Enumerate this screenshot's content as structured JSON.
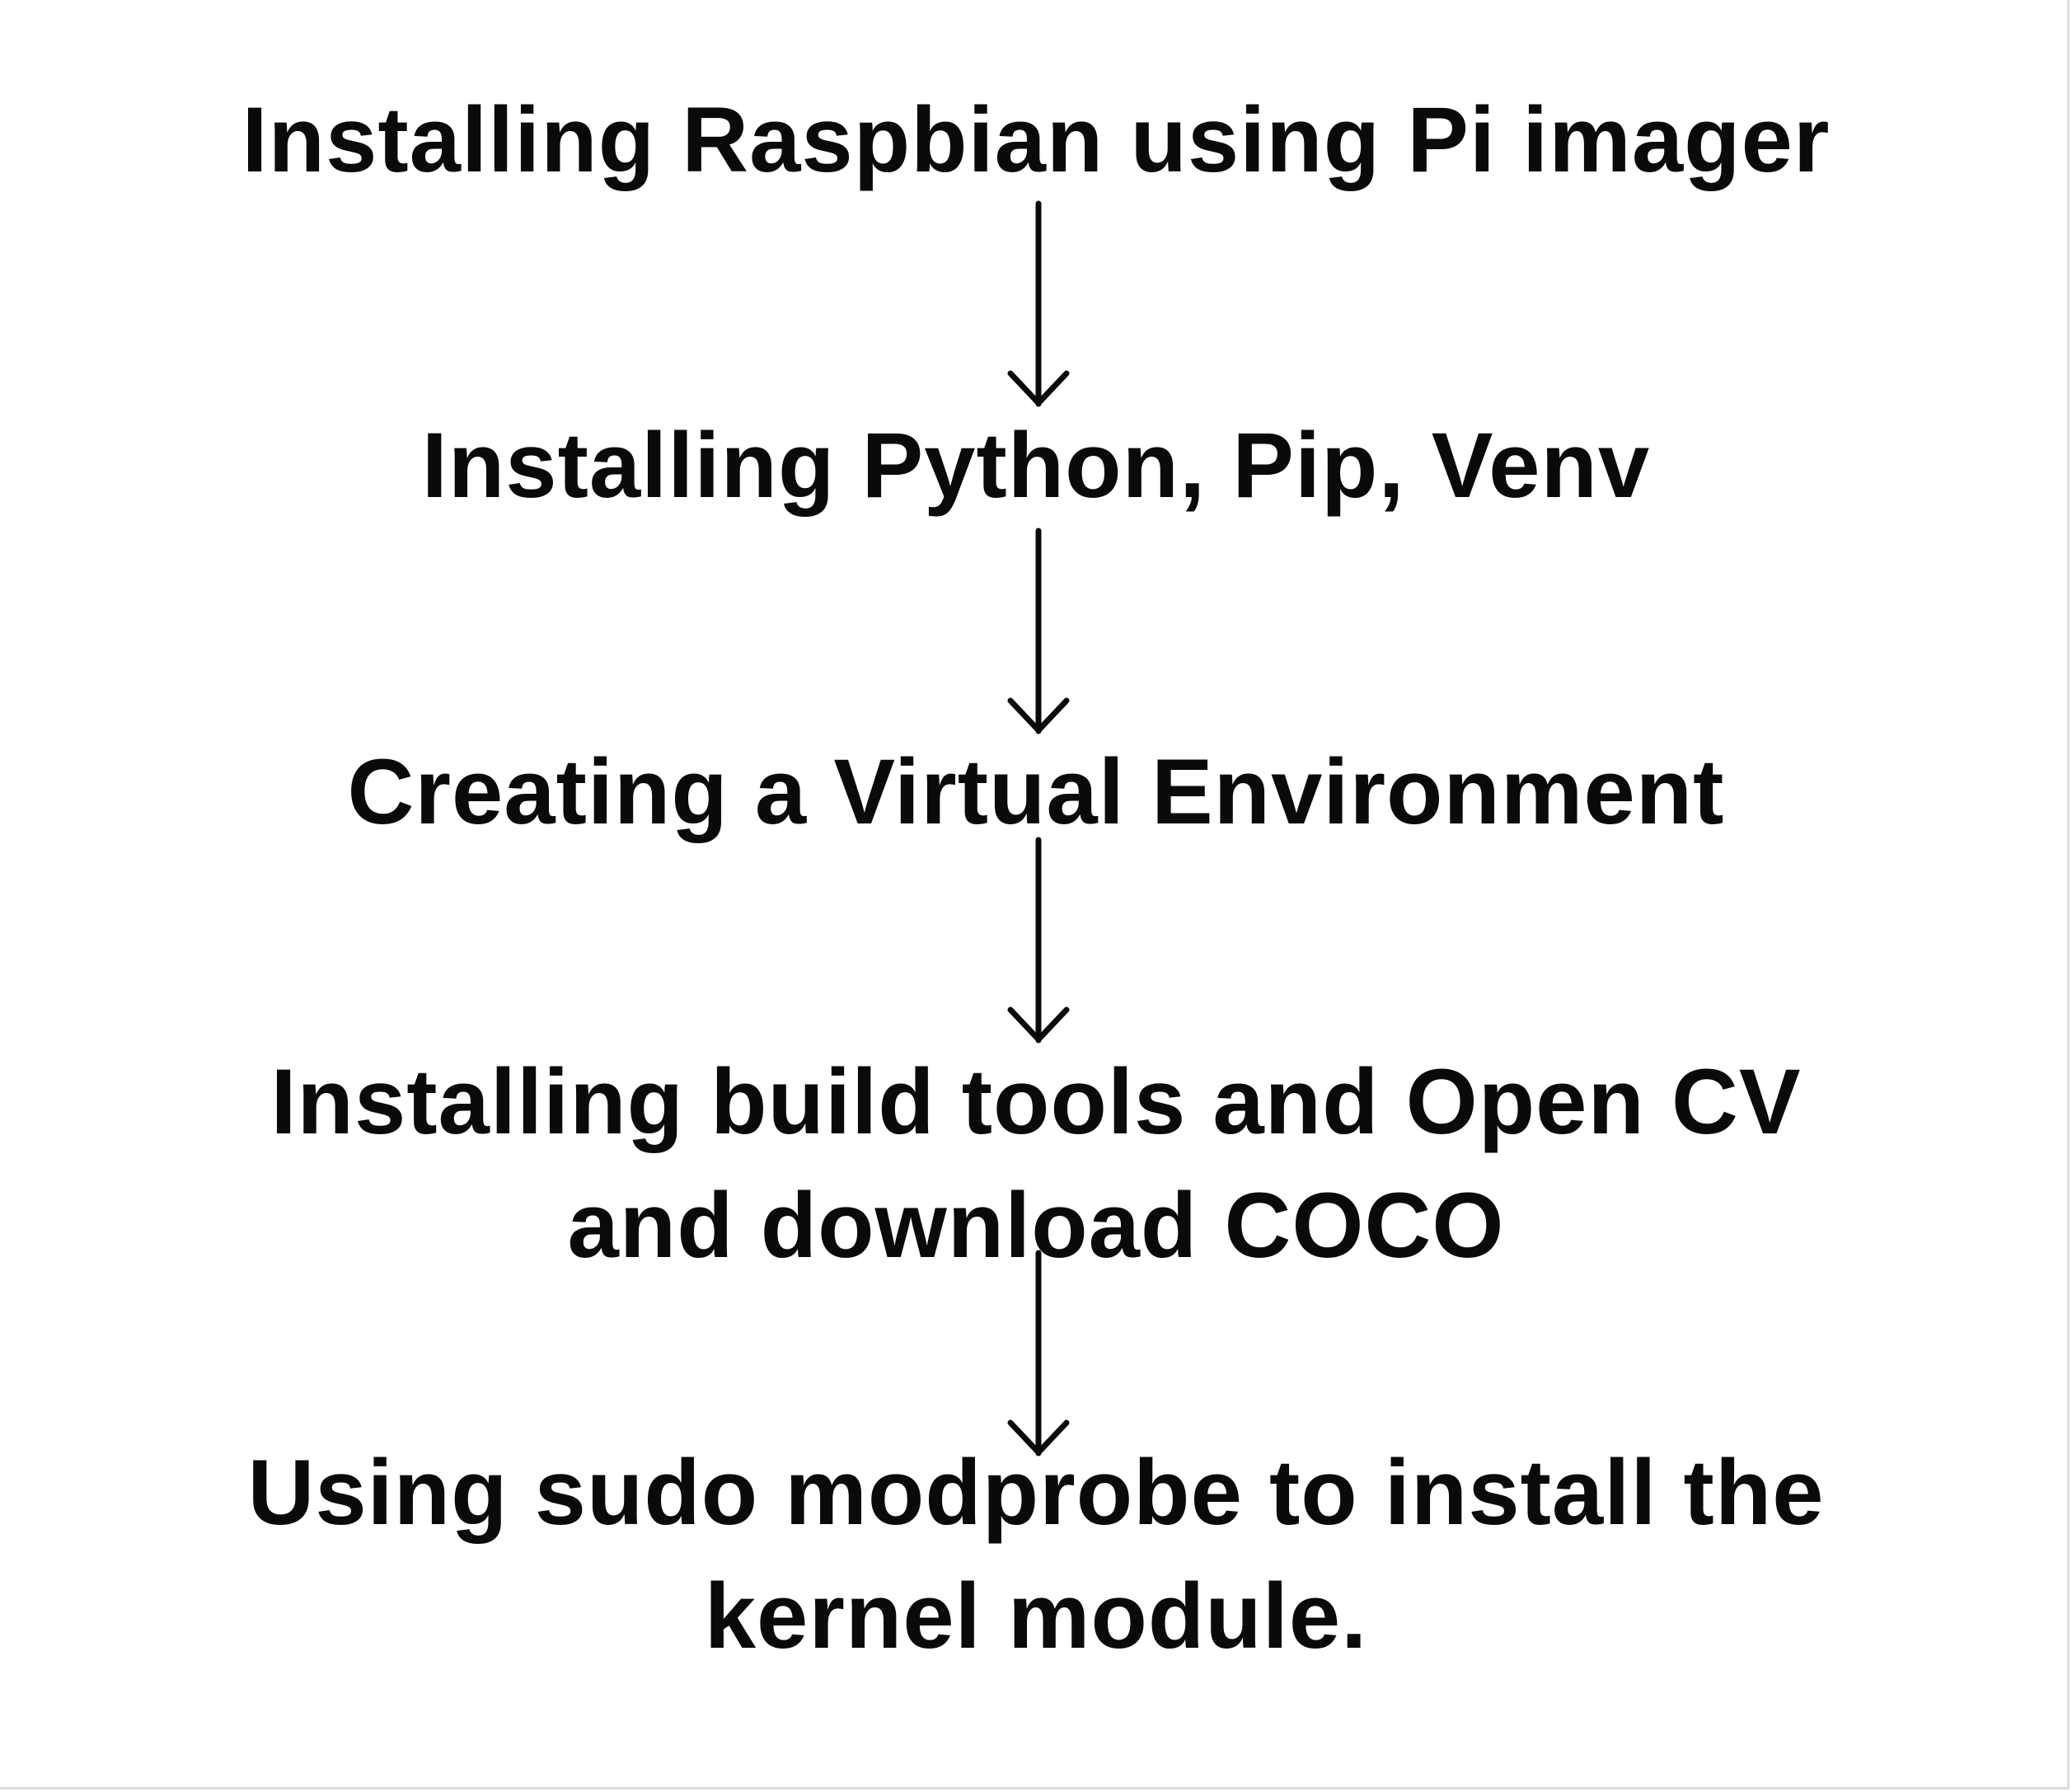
{
  "flow": {
    "steps": [
      {
        "lines": [
          "Installing Raspbian using Pi imager"
        ]
      },
      {
        "lines": [
          "Installing Python, Pip, Venv"
        ]
      },
      {
        "lines": [
          "Creating a Virtual Environment"
        ]
      },
      {
        "lines": [
          "Installing build tools and Open CV",
          "and download COCO"
        ]
      },
      {
        "lines": [
          "Using sudo modprobe to install the",
          "kernel module."
        ]
      }
    ],
    "arrow_color": "#0a0a0a",
    "text_color": "#0a0a0a",
    "background": "#ffffff"
  }
}
